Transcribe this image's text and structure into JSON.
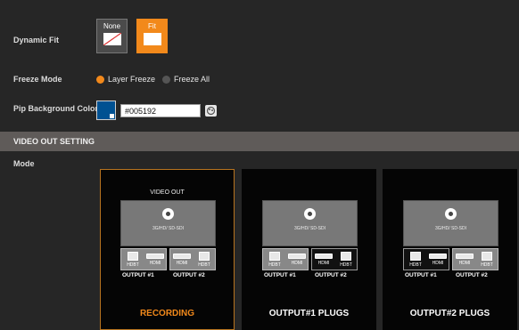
{
  "dynamic_fit": {
    "label": "Dynamic Fit",
    "options": [
      {
        "label": "None",
        "selected": false
      },
      {
        "label": "Fit",
        "selected": true
      }
    ]
  },
  "freeze_mode": {
    "label": "Freeze Mode",
    "options": [
      {
        "label": "Layer Freeze",
        "selected": true
      },
      {
        "label": "Freeze All",
        "selected": false
      }
    ]
  },
  "pip_background": {
    "label": "Pip Background Color",
    "value": "#005192",
    "color": "#005192"
  },
  "section": {
    "title": "VIDEO OUT SETTING"
  },
  "mode": {
    "label": "Mode",
    "cards": [
      {
        "title": "RECORDING",
        "selected": true,
        "header": "VIDEO OUT",
        "sdi": "3G/HD/ SD-SDI",
        "ports": [
          "HDBT",
          "HDMI",
          "HDMI",
          "HDBT"
        ],
        "outputs": [
          "OUTPUT #1",
          "OUTPUT #2"
        ]
      },
      {
        "title": "OUTPUT#1 PLUGS",
        "selected": false,
        "sdi": "3G/HD/ SD-SDI",
        "ports": [
          "HDBT",
          "HDMI",
          "HDMI",
          "HDBT"
        ],
        "outputs": [
          "OUTPUT #1",
          "OUTPUT #2"
        ]
      },
      {
        "title": "OUTPUT#2 PLUGS",
        "selected": false,
        "sdi": "3G/HD/ SD-SDI",
        "ports": [
          "HDBT",
          "HDMI",
          "HDMI",
          "HDBT"
        ],
        "outputs": [
          "OUTPUT #1",
          "OUTPUT #2"
        ]
      }
    ]
  },
  "colors": {
    "accent": "#f2891b",
    "background": "#262626",
    "section_bar": "#5f5b59"
  },
  "icons": {
    "color_picker": "palette-icon",
    "sdi": "bnc-connector-icon"
  }
}
